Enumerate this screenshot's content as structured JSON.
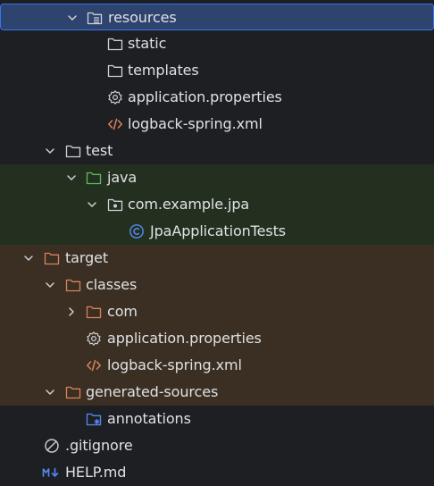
{
  "colors": {
    "background": "#1e1f22",
    "selection": "#2e436e",
    "selection_border": "#3574f0",
    "test_band": "#24301f",
    "target_band": "#3a2f22",
    "folder_default": "#ced0d6",
    "folder_test": "#5fb865",
    "folder_excluded": "#d9825b",
    "xml_icon": "#d9825b",
    "class_icon": "#548af7",
    "markdown_icon": "#548af7"
  },
  "tree": [
    {
      "label": "resources",
      "icon": "resources-folder-icon",
      "expanded": true,
      "selected": true
    },
    {
      "label": "static",
      "icon": "folder-icon"
    },
    {
      "label": "templates",
      "icon": "folder-icon"
    },
    {
      "label": "application.properties",
      "icon": "settings-gear-icon"
    },
    {
      "label": "logback-spring.xml",
      "icon": "xml-code-icon"
    },
    {
      "label": "test",
      "icon": "folder-icon",
      "expanded": true
    },
    {
      "label": "java",
      "icon": "test-sources-folder-icon",
      "expanded": true
    },
    {
      "label": "com.example.jpa",
      "icon": "package-icon",
      "expanded": true
    },
    {
      "label": "JpaApplicationTests",
      "icon": "class-icon"
    },
    {
      "label": "target",
      "icon": "excluded-folder-icon",
      "expanded": true
    },
    {
      "label": "classes",
      "icon": "excluded-folder-icon",
      "expanded": true
    },
    {
      "label": "com",
      "icon": "excluded-folder-icon",
      "expanded": false
    },
    {
      "label": "application.properties",
      "icon": "settings-gear-icon"
    },
    {
      "label": "logback-spring.xml",
      "icon": "xml-code-icon"
    },
    {
      "label": "generated-sources",
      "icon": "excluded-folder-icon",
      "expanded": true
    },
    {
      "label": "annotations",
      "icon": "generated-folder-icon"
    },
    {
      "label": ".gitignore",
      "icon": "ignored-file-icon"
    },
    {
      "label": "HELP.md",
      "icon": "markdown-icon"
    }
  ]
}
